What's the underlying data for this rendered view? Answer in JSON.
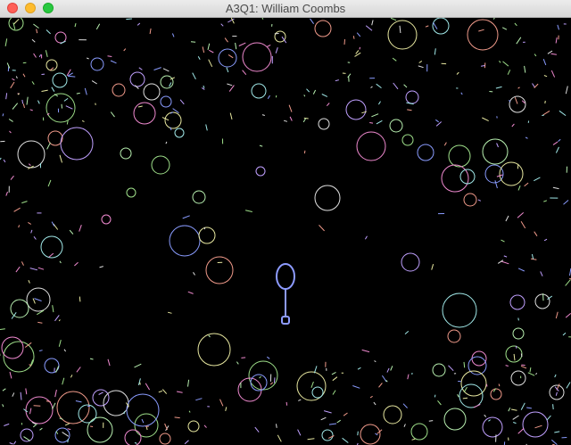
{
  "window": {
    "title": "A3Q1: William Coombs",
    "controls": [
      {
        "name": "close",
        "color": "#fe5f57",
        "border": "#e0443e"
      },
      {
        "name": "minimize",
        "color": "#febc2e",
        "border": "#dea123"
      },
      {
        "name": "maximize",
        "color": "#28c840",
        "border": "#1aab29"
      }
    ]
  },
  "scene": {
    "background": "#000000",
    "player_color": "#8d9bff",
    "palette": [
      "#9fe08a",
      "#f08ad0",
      "#8a9cff",
      "#e8e8a0",
      "#a0e8e8",
      "#f09a8a",
      "#c0a0ff",
      "#e0e0e0",
      "#b8f0b0"
    ],
    "circle_count": 97,
    "particle_count": 470
  }
}
